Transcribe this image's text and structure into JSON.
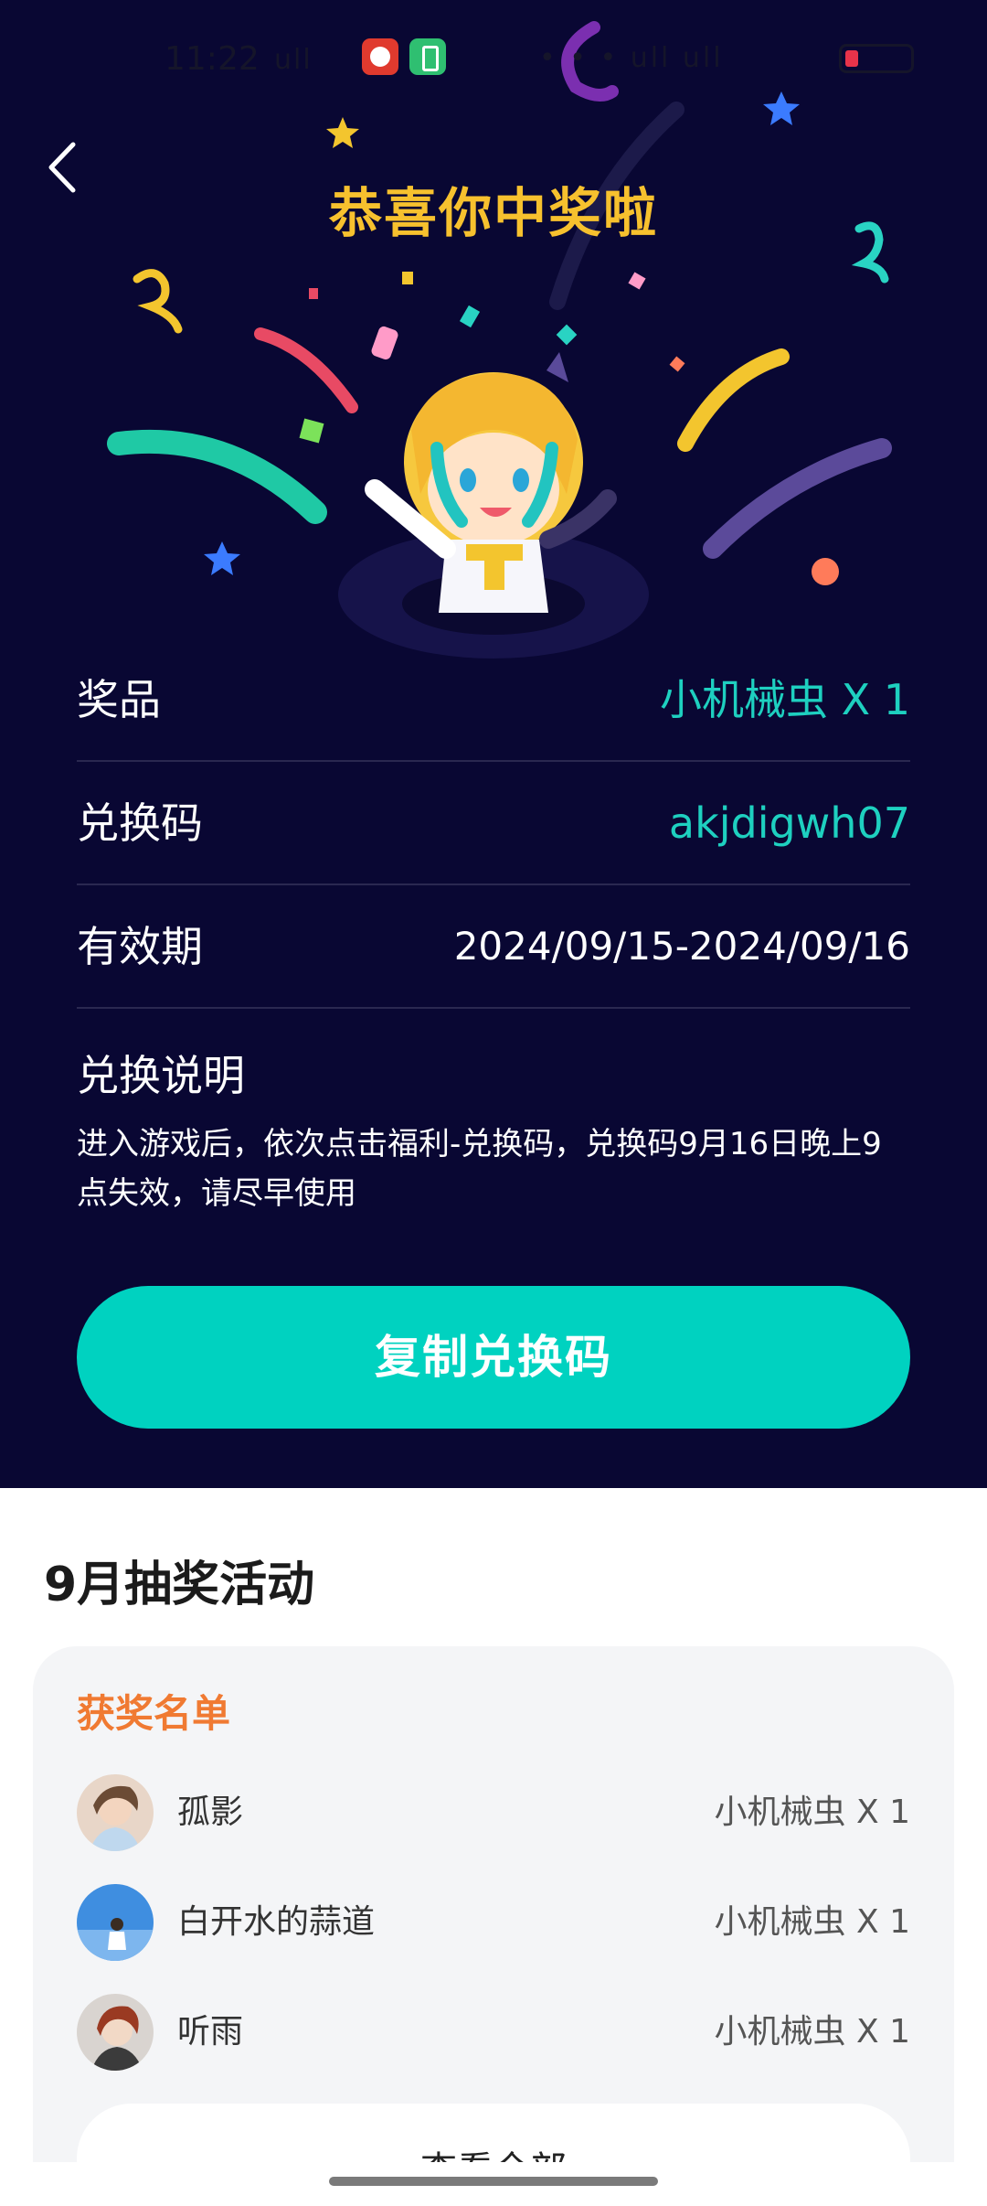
{
  "status_bar": {
    "time": "11:22",
    "signal_text": "ull",
    "right_icons_text": "• • • ull ull"
  },
  "header": {
    "back_icon": "chevron-left-icon",
    "title": "恭喜你中奖啦"
  },
  "prize_info": {
    "prize_label": "奖品",
    "prize_value": "小机械虫 X 1",
    "code_label": "兑换码",
    "code_value": "akjdigwh07",
    "validity_label": "有效期",
    "validity_value": "2024/09/15-2024/09/16",
    "instructions_title": "兑换说明",
    "instructions_text": "进入游戏后，依次点击福利-兑换码，兑换码9月16日晚上9点失效，请尽早使用"
  },
  "copy_button_label": "复制兑换码",
  "activity": {
    "title": "9月抽奖活动",
    "winners_title": "获奖名单",
    "winners": [
      {
        "name": "孤影",
        "prize": "小机械虫 X 1"
      },
      {
        "name": "白开水的蒜道",
        "prize": "小机械虫 X 1"
      },
      {
        "name": "听雨",
        "prize": "小机械虫 X 1"
      }
    ],
    "view_all_label": "查看全部"
  },
  "colors": {
    "background_dark": "#090733",
    "accent_teal": "#00d2c0",
    "title_gold": "#f7c12e",
    "winners_orange": "#f07a32"
  }
}
